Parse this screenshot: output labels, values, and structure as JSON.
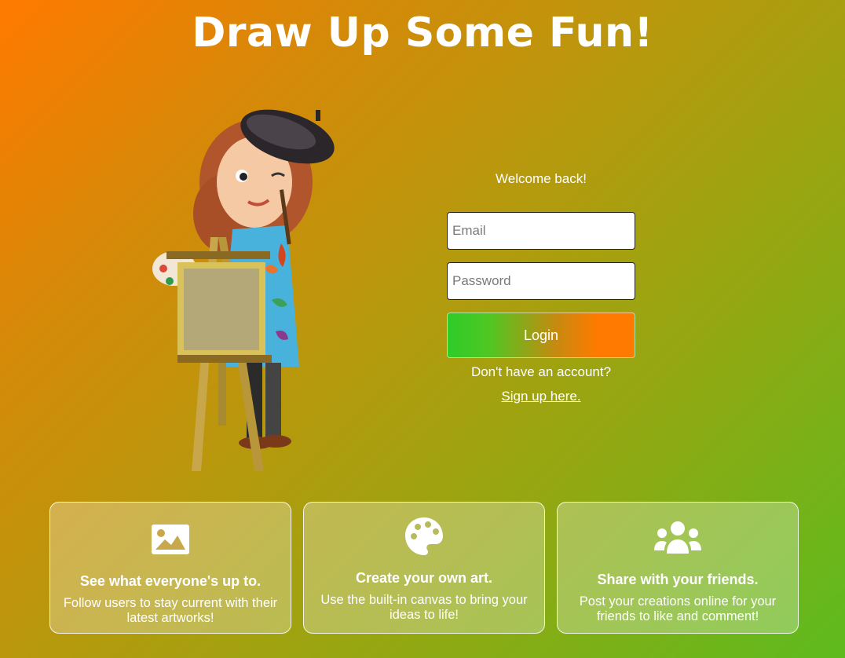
{
  "page": {
    "title": "Draw Up Some Fun!"
  },
  "hero": {
    "image": "painter-at-easel-illustration"
  },
  "login": {
    "welcome": "Welcome back!",
    "email_placeholder": "Email",
    "password_placeholder": "Password",
    "login_label": "Login",
    "no_account_text": "Don't have an account?",
    "signup_link": "Sign up here."
  },
  "features": [
    {
      "icon": "image-icon",
      "title": "See what everyone's up to.",
      "text": "Follow users to stay current with their latest artworks!"
    },
    {
      "icon": "palette-icon",
      "title": "Create your own art.",
      "text": "Use the built-in canvas to bring your ideas to life!"
    },
    {
      "icon": "users-icon",
      "title": "Share with your friends.",
      "text": "Post your creations online for your friends to like and comment!"
    }
  ],
  "colors": {
    "login_gradient_start": "#2fcc2a",
    "login_gradient_end": "#ff7a00"
  }
}
